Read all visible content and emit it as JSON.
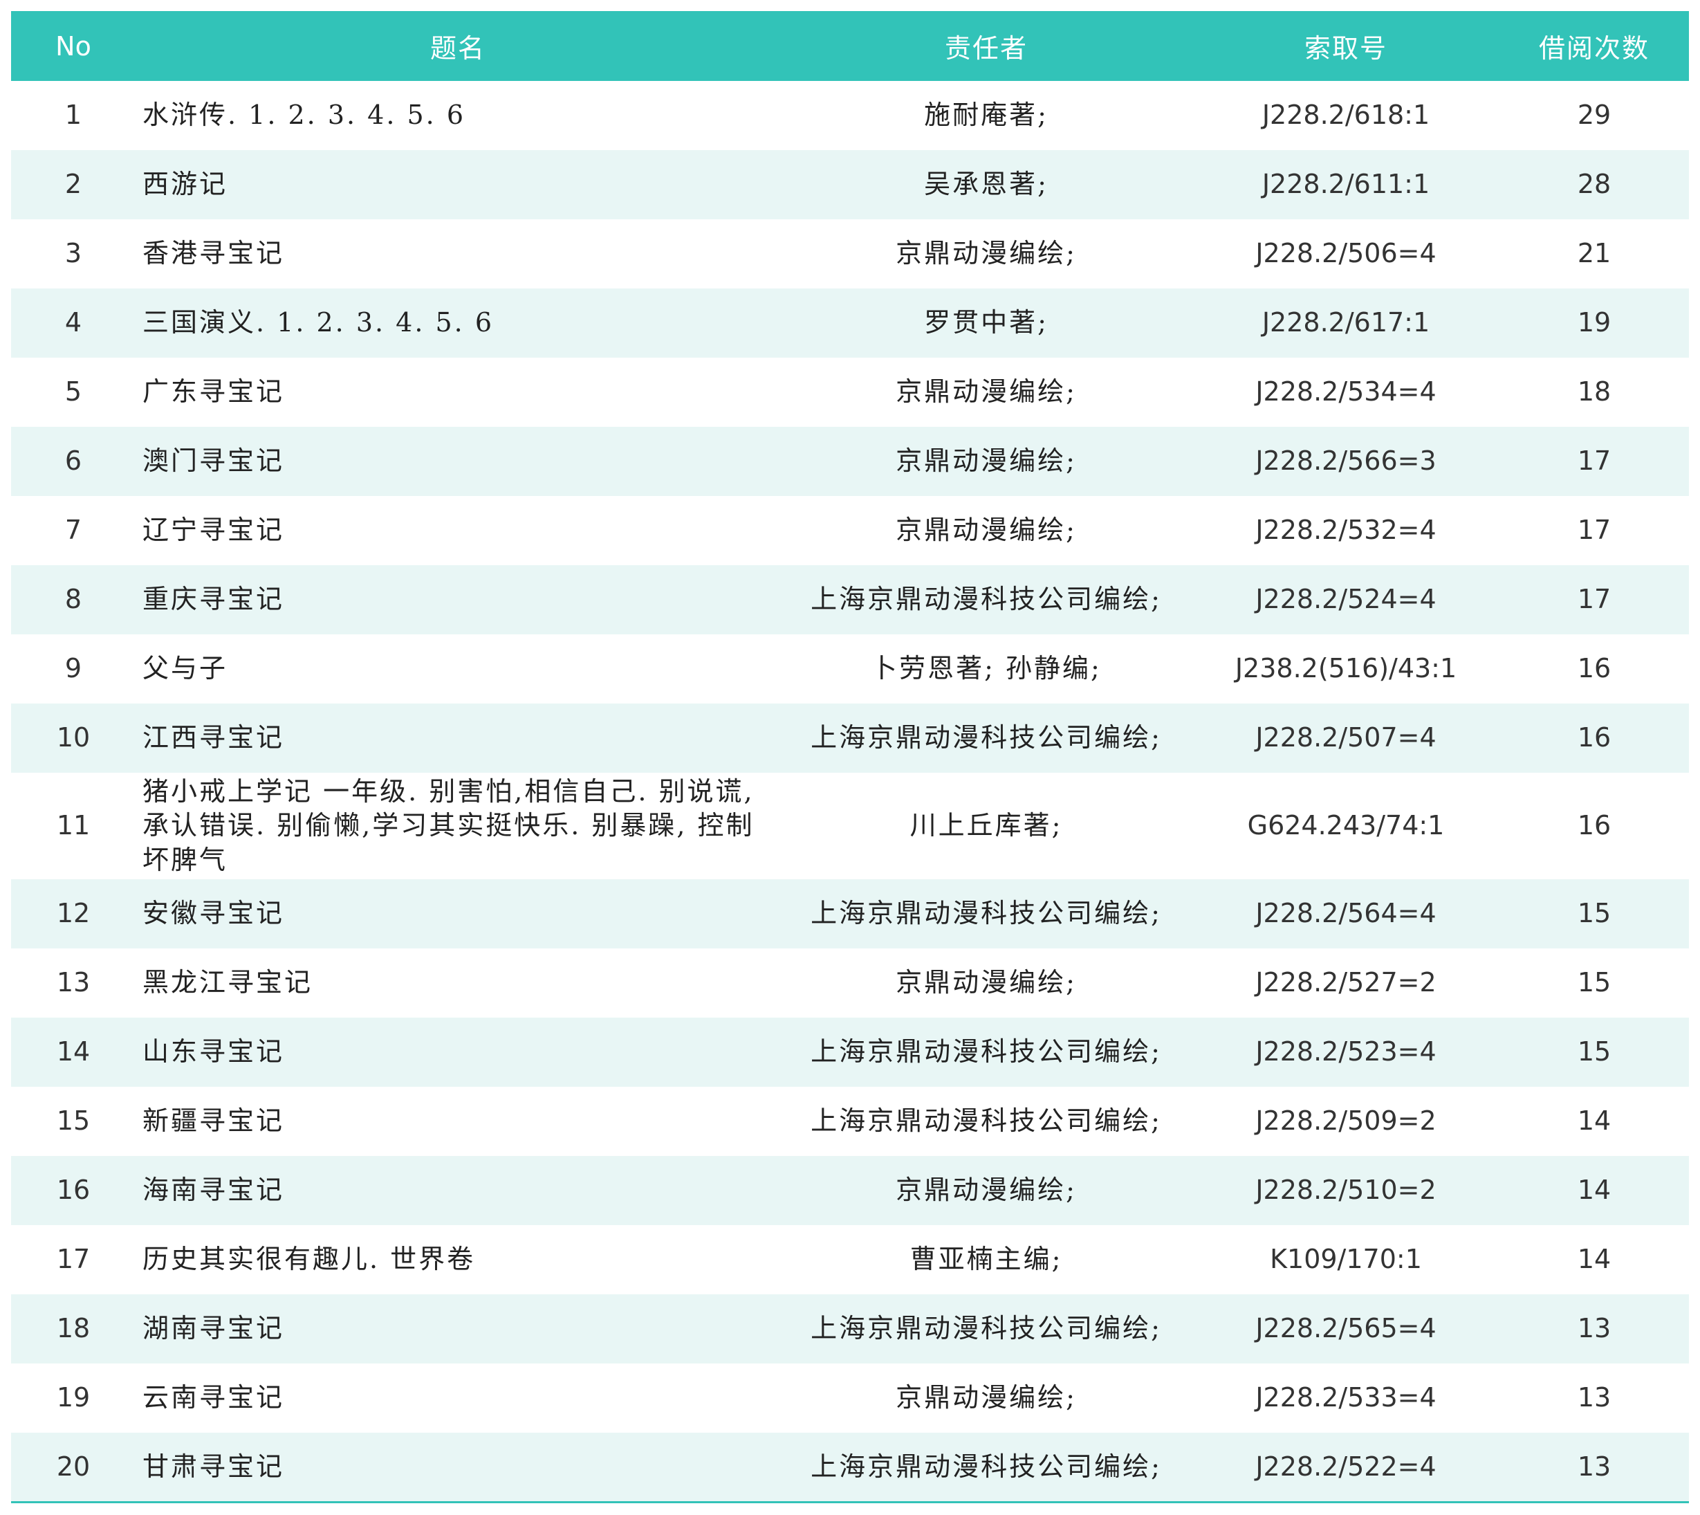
{
  "headers": {
    "no": "No",
    "title": "题名",
    "responsibility": "责任者",
    "call_number": "索取号",
    "borrow_count": "借阅次数"
  },
  "rows": [
    {
      "no": "1",
      "title": "水浒传. 1. 2. 3. 4. 5. 6",
      "responsibility": "施耐庵著;",
      "call_number": "J228.2/618:1",
      "borrow_count": "29"
    },
    {
      "no": "2",
      "title": "西游记",
      "responsibility": "吴承恩著;",
      "call_number": "J228.2/611:1",
      "borrow_count": "28"
    },
    {
      "no": "3",
      "title": "香港寻宝记",
      "responsibility": "京鼎动漫编绘;",
      "call_number": "J228.2/506=4",
      "borrow_count": "21"
    },
    {
      "no": "4",
      "title": "三国演义. 1. 2. 3. 4. 5. 6",
      "responsibility": "罗贯中著;",
      "call_number": "J228.2/617:1",
      "borrow_count": "19"
    },
    {
      "no": "5",
      "title": "广东寻宝记",
      "responsibility": "京鼎动漫编绘;",
      "call_number": "J228.2/534=4",
      "borrow_count": "18"
    },
    {
      "no": "6",
      "title": "澳门寻宝记",
      "responsibility": "京鼎动漫编绘;",
      "call_number": "J228.2/566=3",
      "borrow_count": "17"
    },
    {
      "no": "7",
      "title": "辽宁寻宝记",
      "responsibility": "京鼎动漫编绘;",
      "call_number": "J228.2/532=4",
      "borrow_count": "17"
    },
    {
      "no": "8",
      "title": "重庆寻宝记",
      "responsibility": "上海京鼎动漫科技公司编绘;",
      "call_number": "J228.2/524=4",
      "borrow_count": "17"
    },
    {
      "no": "9",
      "title": "父与子",
      "responsibility": "卜劳恩著; 孙静编;",
      "call_number": "J238.2(516)/43:1",
      "borrow_count": "16"
    },
    {
      "no": "10",
      "title": "江西寻宝记",
      "responsibility": "上海京鼎动漫科技公司编绘;",
      "call_number": "J228.2/507=4",
      "borrow_count": "16"
    },
    {
      "no": "11",
      "title": "猪小戒上学记 一年级. 别害怕,相信自己. 别说谎,承认错误. 别偷懒,学习其实挺快乐. 别暴躁, 控制坏脾气",
      "responsibility": "川上丘库著;",
      "call_number": "G624.243/74:1",
      "borrow_count": "16"
    },
    {
      "no": "12",
      "title": "安徽寻宝记",
      "responsibility": "上海京鼎动漫科技公司编绘;",
      "call_number": "J228.2/564=4",
      "borrow_count": "15"
    },
    {
      "no": "13",
      "title": "黑龙江寻宝记",
      "responsibility": "京鼎动漫编绘;",
      "call_number": "J228.2/527=2",
      "borrow_count": "15"
    },
    {
      "no": "14",
      "title": "山东寻宝记",
      "responsibility": "上海京鼎动漫科技公司编绘;",
      "call_number": "J228.2/523=4",
      "borrow_count": "15"
    },
    {
      "no": "15",
      "title": "新疆寻宝记",
      "responsibility": "上海京鼎动漫科技公司编绘;",
      "call_number": "J228.2/509=2",
      "borrow_count": "14"
    },
    {
      "no": "16",
      "title": "海南寻宝记",
      "responsibility": "京鼎动漫编绘;",
      "call_number": "J228.2/510=2",
      "borrow_count": "14"
    },
    {
      "no": "17",
      "title": "历史其实很有趣儿. 世界卷",
      "responsibility": "曹亚楠主编;",
      "call_number": "K109/170:1",
      "borrow_count": "14"
    },
    {
      "no": "18",
      "title": "湖南寻宝记",
      "responsibility": "上海京鼎动漫科技公司编绘;",
      "call_number": "J228.2/565=4",
      "borrow_count": "13"
    },
    {
      "no": "19",
      "title": "云南寻宝记",
      "responsibility": "京鼎动漫编绘;",
      "call_number": "J228.2/533=4",
      "borrow_count": "13"
    },
    {
      "no": "20",
      "title": "甘肃寻宝记",
      "responsibility": "上海京鼎动漫科技公司编绘;",
      "call_number": "J228.2/522=4",
      "borrow_count": "13"
    }
  ]
}
